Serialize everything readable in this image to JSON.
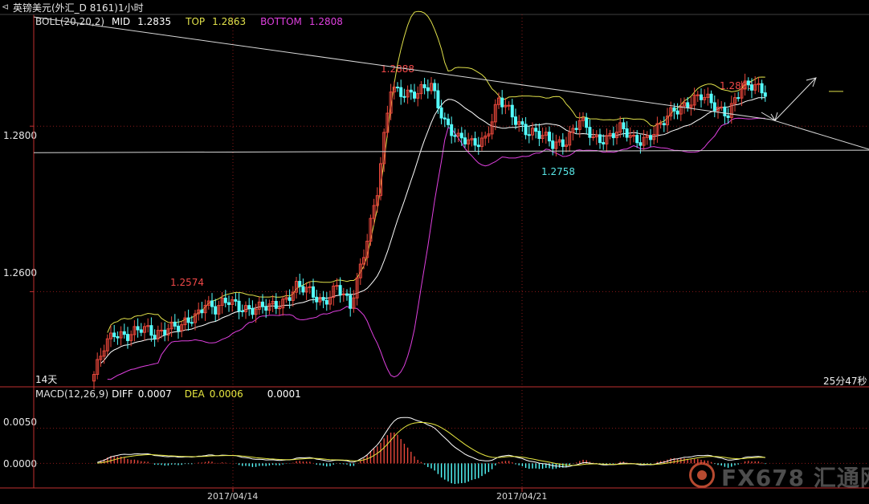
{
  "window": {
    "arrow": "⊲",
    "title": "英镑美元(外汇_D 8161)1小时"
  },
  "boll": {
    "label": "BOLL(20,20,2)",
    "mid_label": "MID",
    "mid_value": "1.2835",
    "top_label": "TOP",
    "top_value": "1.2863",
    "bottom_label": "BOTTOM",
    "bottom_value": "1.2808"
  },
  "macd": {
    "label": "MACD(12,26,9)",
    "diff_label": "DIFF",
    "diff_value": "0.0007",
    "dea_label": "DEA",
    "dea_value": "0.0006",
    "macd_value": "0.0001"
  },
  "price_axis": {
    "ticks": [
      "1.2800",
      "1.2600"
    ]
  },
  "macd_axis": {
    "ticks": [
      "0.0050",
      "0.0000"
    ]
  },
  "time_axis": {
    "ticks": [
      "2017/04/14",
      "2017/04/21"
    ]
  },
  "annotations": {
    "high_1": "1.2574",
    "high_2": "1.2888",
    "low_1": "1.2758",
    "high_3": "1.2863",
    "days": "14天",
    "countdown": "25分47秒"
  },
  "watermark": {
    "text": "FX678 汇通网"
  },
  "colors": {
    "background": "#000000",
    "up_candle": "#e8473b",
    "down_candle": "#54ffff",
    "boll_mid": "#ffffff",
    "boll_top": "#e0e04a",
    "boll_bottom": "#e040e0",
    "diff_line": "#ffffff",
    "dea_line": "#e8e840",
    "annotation_red": "#f04848",
    "annotation_cyan": "#58e8e8",
    "axis_text": "#e0e0e0",
    "grid_red": "#8a1a1a"
  },
  "chart_data": [
    {
      "type": "candlestick",
      "title": "英镑美元(外汇_D 8161)1小时",
      "indicator": "BOLL(20,20,2)",
      "y_ticks": [
        1.28,
        1.26
      ],
      "ylim": [
        1.2485,
        1.2935
      ],
      "x_ticks": [
        "2017/04/14",
        "2017/04/21"
      ],
      "annotated_levels": [
        {
          "label": "1.2574",
          "value": 1.2574
        },
        {
          "label": "1.2888",
          "value": 1.2888
        },
        {
          "label": "1.2758",
          "value": 1.2758
        },
        {
          "label": "1.2863",
          "value": 1.2863
        }
      ],
      "boll_last": {
        "mid": 1.2835,
        "top": 1.2863,
        "bottom": 1.2808
      },
      "close_path": [
        [
          0,
          1.25
        ],
        [
          3,
          1.253
        ],
        [
          6,
          1.255
        ],
        [
          10,
          1.255
        ],
        [
          14,
          1.2553
        ],
        [
          18,
          1.2548
        ],
        [
          22,
          1.256
        ],
        [
          26,
          1.2555
        ],
        [
          30,
          1.257
        ],
        [
          33,
          1.259
        ],
        [
          36,
          1.2578
        ],
        [
          40,
          1.2587
        ],
        [
          44,
          1.2583
        ],
        [
          48,
          1.2578
        ],
        [
          52,
          1.258
        ],
        [
          56,
          1.259
        ],
        [
          60,
          1.2605
        ],
        [
          64,
          1.2598
        ],
        [
          68,
          1.259
        ],
        [
          72,
          1.2605
        ],
        [
          76,
          1.258
        ],
        [
          80,
          1.265
        ],
        [
          84,
          1.272
        ],
        [
          88,
          1.2845
        ],
        [
          92,
          1.2843
        ],
        [
          96,
          1.2838
        ],
        [
          100,
          1.2848
        ],
        [
          104,
          1.2808
        ],
        [
          108,
          1.2783
        ],
        [
          112,
          1.2778
        ],
        [
          116,
          1.2788
        ],
        [
          120,
          1.283
        ],
        [
          124,
          1.2812
        ],
        [
          128,
          1.2798
        ],
        [
          132,
          1.2788
        ],
        [
          136,
          1.2778
        ],
        [
          140,
          1.2785
        ],
        [
          144,
          1.2805
        ],
        [
          148,
          1.2785
        ],
        [
          152,
          1.2788
        ],
        [
          156,
          1.2795
        ],
        [
          160,
          1.2783
        ],
        [
          164,
          1.2788
        ],
        [
          168,
          1.2798
        ],
        [
          172,
          1.282
        ],
        [
          176,
          1.283
        ],
        [
          180,
          1.2834
        ],
        [
          184,
          1.2825
        ],
        [
          188,
          1.2818
        ],
        [
          192,
          1.2843
        ],
        [
          196,
          1.285
        ],
        [
          199,
          1.2845
        ]
      ]
    },
    {
      "type": "macd",
      "indicator": "MACD(12,26,9)",
      "y_ticks": [
        0.005,
        0.0
      ],
      "ylim": [
        -0.0035,
        0.0093
      ],
      "last": {
        "diff": 0.0007,
        "dea": 0.0006,
        "macd": 0.0001
      }
    }
  ]
}
